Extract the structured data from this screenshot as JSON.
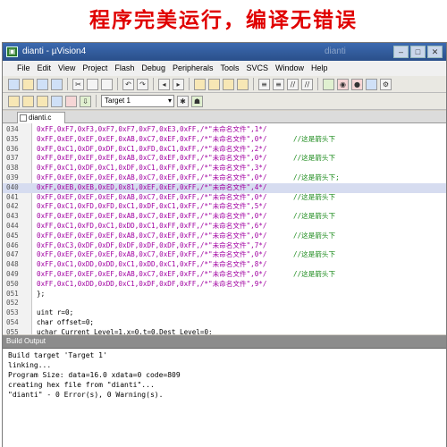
{
  "banner": "程序完美运行，编译无错误",
  "window": {
    "title": "dianti - µVision4",
    "ghost_title": "dianti"
  },
  "menu": [
    "File",
    "Edit",
    "View",
    "Project",
    "Flash",
    "Debug",
    "Peripherals",
    "Tools",
    "SVCS",
    "Window",
    "Help"
  ],
  "toolbar": {
    "target": "Target 1"
  },
  "tab": {
    "label": "dianti.c"
  },
  "code_lines": [
    {
      "num": "034",
      "code": "0xFF,0xF7,0xF3,0xF7,0xF7,0xF7,0xE3,0xFF,/*\"未命名文件\",1*/",
      "cmt": ""
    },
    {
      "num": "035",
      "code": "0xFF,0xEF,0xEF,0xEF,0xAB,0xC7,0xEF,0xFF,/*\"未命名文件\",0*/",
      "cmt": "//这是箭头下"
    },
    {
      "num": "036",
      "code": "0xFF,0xC1,0xDF,0xDF,0xC1,0xFD,0xC1,0xFF,/*\"未命名文件\",2*/",
      "cmt": ""
    },
    {
      "num": "037",
      "code": "0xFF,0xEF,0xEF,0xEF,0xAB,0xC7,0xEF,0xFF,/*\"未命名文件\",0*/",
      "cmt": "//这是箭头下"
    },
    {
      "num": "038",
      "code": "0xFF,0xC1,0xDF,0xC1,0xDF,0xC1,0xFF,0xFF,/*\"未命名文件\",3*/",
      "cmt": ""
    },
    {
      "num": "039",
      "code": "0xFF,0xEF,0xEF,0xEF,0xAB,0xC7,0xEF,0xFF,/*\"未命名文件\",0*/",
      "cmt": "//这是箭头下;"
    },
    {
      "num": "040",
      "code": "0xFF,0xEB,0xEB,0xED,0x81,0xEF,0xEF,0xFF,/*\"未命名文件\",4*/",
      "cmt": ""
    },
    {
      "num": "041",
      "code": "0xFF,0xEF,0xEF,0xEF,0xAB,0xC7,0xEF,0xFF,/*\"未命名文件\",0*/",
      "cmt": "//这是箭头下"
    },
    {
      "num": "042",
      "code": "0xFF,0xC1,0xFD,0xFD,0xC1,0xDF,0xC1,0xFF,/*\"未命名文件\",5*/",
      "cmt": ""
    },
    {
      "num": "043",
      "code": "0xFF,0xEF,0xEF,0xEF,0xAB,0xC7,0xEF,0xFF,/*\"未命名文件\",0*/",
      "cmt": "//这是箭头下"
    },
    {
      "num": "044",
      "code": "0xFF,0xC1,0xFD,0xC1,0xDD,0xC1,0xFF,0xFF,/*\"未命名文件\",6*/",
      "cmt": ""
    },
    {
      "num": "045",
      "code": "0xFF,0xEF,0xEF,0xEF,0xAB,0xC7,0xEF,0xFF,/*\"未命名文件\",0*/",
      "cmt": "//这是箭头下"
    },
    {
      "num": "046",
      "code": "0xFF,0xC3,0xDF,0xDF,0xDF,0xDF,0xDF,0xFF,/*\"未命名文件\",7*/",
      "cmt": ""
    },
    {
      "num": "047",
      "code": "0xFF,0xEF,0xEF,0xEF,0xAB,0xC7,0xEF,0xFF,/*\"未命名文件\",0*/",
      "cmt": "//这是箭头下"
    },
    {
      "num": "048",
      "code": "0xFF,0xC1,0xDD,0xDD,0xC1,0xDD,0xC1,0xFF,/*\"未命名文件\",8*/",
      "cmt": ""
    },
    {
      "num": "049",
      "code": "0xFF,0xEF,0xEF,0xEF,0xAB,0xC7,0xEF,0xFF,/*\"未命名文件\",0*/",
      "cmt": "//这是箭头下"
    },
    {
      "num": "050",
      "code": "0xFF,0xC1,0xDD,0xDD,0xC1,0xDF,0xDF,0xFF,/*\"未命名文件\",9*/",
      "cmt": ""
    },
    {
      "num": "051",
      "code": "};",
      "cmt": ""
    },
    {
      "num": "052",
      "code": "",
      "cmt": ""
    },
    {
      "num": "053",
      "code": "uint r=0;",
      "cmt": ""
    },
    {
      "num": "054",
      "code": "char offset=0;",
      "cmt": ""
    },
    {
      "num": "055",
      "code": "uchar Current_Level=1,x=0,t=0,Dest_Level=0;",
      "cmt": ""
    },
    {
      "num": "056",
      "code": "",
      "cmt": ""
    }
  ],
  "highlight_line": "040",
  "output": {
    "header": "Build Output",
    "lines": [
      "Build target 'Target 1'",
      "linking...",
      "Program Size: data=16.0 xdata=0 code=809",
      "creating hex file from \"dianti\"...",
      "\"dianti\" - 0 Error(s), 0 Warning(s)."
    ]
  }
}
